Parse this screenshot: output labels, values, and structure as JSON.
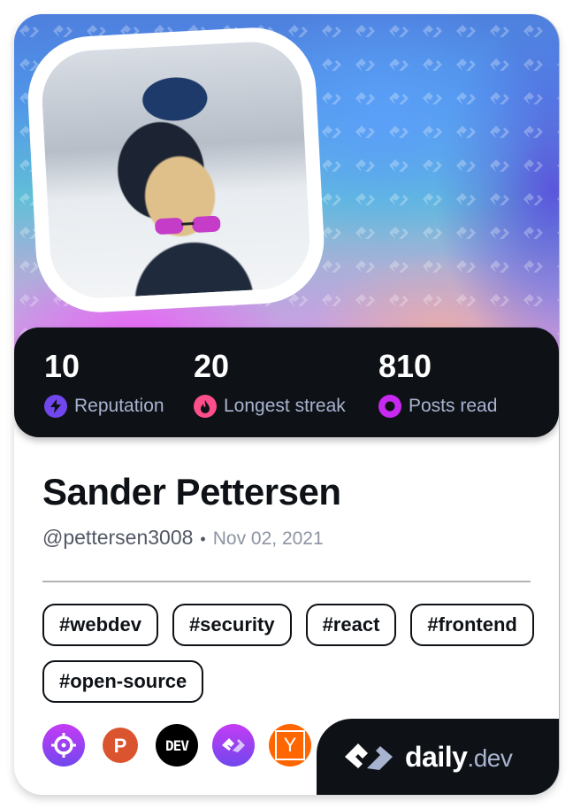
{
  "profile": {
    "name": "Sander Pettersen",
    "handle": "@pettersen3008",
    "separator": "•",
    "joined": "Nov 02, 2021",
    "avatar_alt": "profile-photo"
  },
  "stats": [
    {
      "value": "10",
      "label": "Reputation",
      "icon": "lightning-icon",
      "color": "#7147ed"
    },
    {
      "value": "20",
      "label": "Longest streak",
      "icon": "flame-icon",
      "color": "#ff4f8b"
    },
    {
      "value": "810",
      "label": "Posts read",
      "icon": "ring-icon",
      "color": "#c729f0"
    }
  ],
  "tags": [
    "#webdev",
    "#security",
    "#react",
    "#frontend",
    "#open-source"
  ],
  "sources": [
    {
      "name": "crosshair-source",
      "label": "",
      "color": "#a13cf2"
    },
    {
      "name": "product-hunt-source",
      "label": "P",
      "color": "#da552f"
    },
    {
      "name": "dev-to-source",
      "label": "DEV",
      "color": "#000000"
    },
    {
      "name": "daily-dev-source",
      "label": "",
      "color": "#8a3cf2"
    },
    {
      "name": "hacker-news-source",
      "label": "Y",
      "color": "#ff6600"
    }
  ],
  "brand": {
    "name": "daily",
    "suffix": ".dev"
  },
  "colors": {
    "dark": "#0e1217",
    "label": "#a8b3cf"
  }
}
